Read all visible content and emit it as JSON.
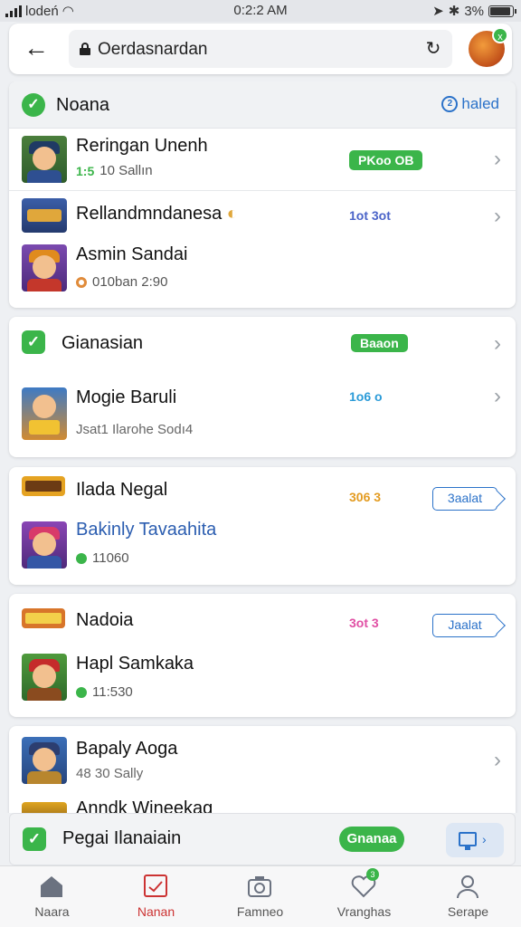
{
  "status_bar": {
    "carrier": "lodeń",
    "time": "0:2:2 AM",
    "battery": "3%"
  },
  "browser": {
    "url": "Oerdasnardan"
  },
  "cards": [
    {
      "header": {
        "title": "Noana",
        "link": "haled"
      },
      "rows": [
        {
          "title": "Reringan Unenh",
          "sub_num": "1:5",
          "sub": "10 Sallın",
          "tag": "PKoo OB",
          "tag_color": "#3bb54a"
        },
        {
          "title": "Rellandmndanesa",
          "tag": "1ot 3ot",
          "tag_color": "#4a63c8"
        },
        {
          "title": "Asmin Sandai",
          "sub": "010ban 2:90"
        }
      ]
    },
    {
      "header": {
        "title": "Gianasian",
        "tag": "Baaon"
      },
      "rows": [
        {
          "title": "Mogie Baruli",
          "tag": "1o6 o",
          "tag_color": "#2b9bd8",
          "sub": "Jsat1 Ilarohe Sodı4"
        }
      ]
    },
    {
      "rows": [
        {
          "title": "Ilada Negal",
          "tag": "306 3",
          "tag_color": "#e39b20",
          "button": "3aalat"
        },
        {
          "title": "Bakinly Tavaahita",
          "sub": "11060"
        }
      ]
    },
    {
      "rows": [
        {
          "title": "Nadoia",
          "tag": "3ot 3",
          "tag_color": "#e04fa4",
          "button": "Jaalat"
        },
        {
          "title": "Hapl Samkaka",
          "sub": "11:530"
        }
      ]
    },
    {
      "rows": [
        {
          "title": "Bapaly Aoga",
          "sub": "48 30 Sally"
        },
        {
          "title": "Anndk Wineekag"
        }
      ]
    }
  ],
  "action_bar": {
    "title": "Pegai Ilanaiain",
    "pill": "Gnanaa"
  },
  "bottom_nav": [
    {
      "label": "Naara",
      "icon": "home-icon"
    },
    {
      "label": "Nanan",
      "icon": "chart-icon"
    },
    {
      "label": "Famneo",
      "icon": "camera-icon"
    },
    {
      "label": "Vranghas",
      "icon": "heart-icon",
      "badge": "3"
    },
    {
      "label": "Serape",
      "icon": "profile-icon"
    }
  ],
  "colors": {
    "accent": "#3bb54a",
    "link": "#2b72c9",
    "background": "#eef0f3"
  }
}
